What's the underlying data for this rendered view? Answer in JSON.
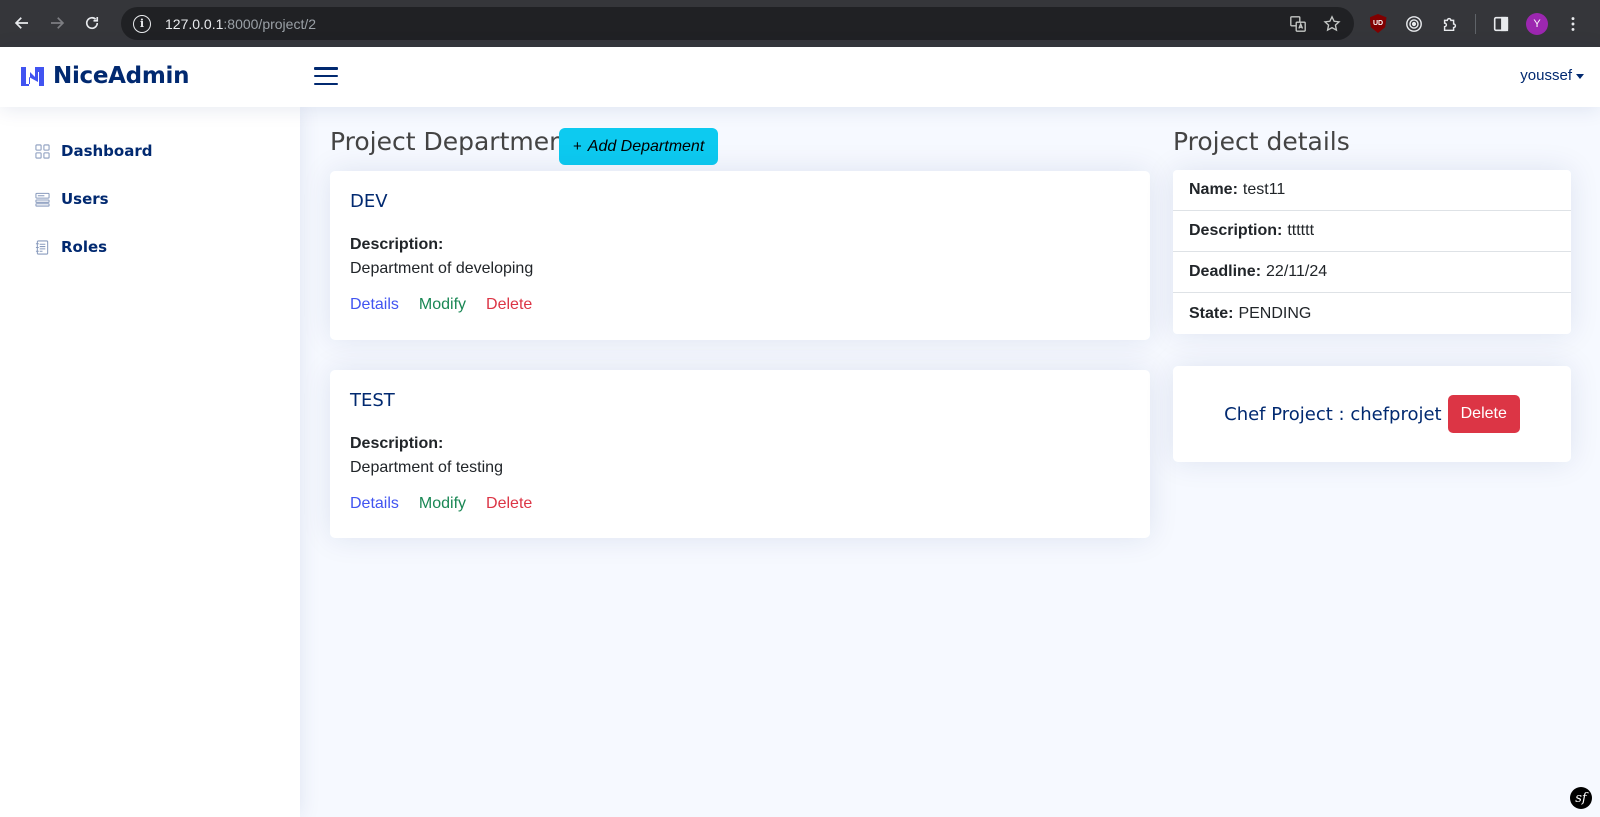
{
  "browser": {
    "url_host": "127.0.0.1",
    "url_path": ":8000/project/2",
    "profile_initial": "Y",
    "ublock_label": "UD"
  },
  "header": {
    "brand": "NiceAdmin",
    "user": "youssef"
  },
  "sidebar": {
    "items": [
      {
        "label": "Dashboard",
        "icon": "grid-icon"
      },
      {
        "label": "Users",
        "icon": "menu-button-icon"
      },
      {
        "label": "Roles",
        "icon": "journal-text-icon"
      }
    ]
  },
  "departments": {
    "title": "Project Departments",
    "add_button": "Add Department",
    "add_icon": "+",
    "items": [
      {
        "name": "DEV",
        "desc_label": "Description:",
        "description": "Department of developing",
        "details": "Details",
        "modify": "Modify",
        "delete": "Delete"
      },
      {
        "name": "TEST",
        "desc_label": "Description:",
        "description": "Department of testing",
        "details": "Details",
        "modify": "Modify",
        "delete": "Delete"
      }
    ]
  },
  "project": {
    "title": "Project details",
    "rows": [
      {
        "label": "Name:",
        "value": "test11"
      },
      {
        "label": "Description:",
        "value": "tttttt"
      },
      {
        "label": "Deadline:",
        "value": "22/11/24"
      },
      {
        "label": "State:",
        "value": "PENDING"
      }
    ],
    "chef_text": "Chef Project : chefprojet",
    "chef_delete": "Delete"
  },
  "footer": {
    "symfony_badge": "sf"
  },
  "colors": {
    "brand": "#012970",
    "accent_info": "#0dcaf0",
    "link_primary": "#4154f1",
    "link_success": "#198754",
    "danger": "#dc3545"
  }
}
